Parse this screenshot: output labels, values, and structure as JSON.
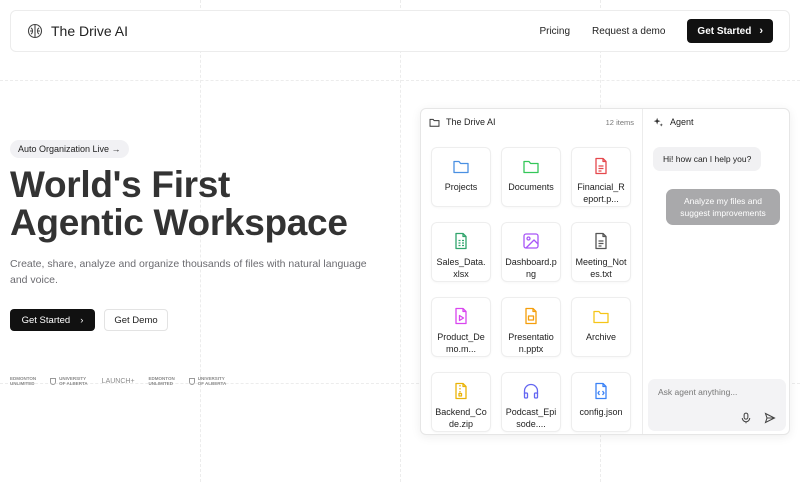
{
  "nav": {
    "brand": "The Drive AI",
    "links": [
      "Pricing",
      "Request a demo"
    ],
    "cta": "Get Started"
  },
  "hero": {
    "badge": "Auto Organization Live →",
    "title_line1": "World's First",
    "title_line2": "Agentic Workspace",
    "subtitle": "Create, share, analyze and organize thousands of files with natural language and voice.",
    "primary_button": "Get Started",
    "secondary_button": "Get Demo"
  },
  "logos": [
    {
      "name": "edmonton-unlimited",
      "line1": "EDMONTON",
      "line2": "UNLIMITED"
    },
    {
      "name": "university-of-alberta",
      "line1": "UNIVERSITY",
      "line2": "OF ALBERTA"
    },
    {
      "name": "launch",
      "text": "LAUNCH+"
    },
    {
      "name": "edmonton-unlimited-2",
      "line1": "EDMONTON",
      "line2": "UNLIMITED"
    },
    {
      "name": "university-of-alberta-2",
      "line1": "UNIVERSITY",
      "line2": "OF ALBERTA"
    }
  ],
  "drive": {
    "title": "The Drive AI",
    "count": "12 items",
    "files": [
      {
        "label": "Projects",
        "icon": "folder-icon",
        "color": "#4a90e2"
      },
      {
        "label": "Documents",
        "icon": "folder-icon",
        "color": "#34c759"
      },
      {
        "label": "Financial_Report.p...",
        "icon": "file-text-icon",
        "color": "#e5484d"
      },
      {
        "label": "Sales_Data.xlsx",
        "icon": "spreadsheet-icon",
        "color": "#30a46c"
      },
      {
        "label": "Dashboard.png",
        "icon": "image-icon",
        "color": "#a855f7"
      },
      {
        "label": "Meeting_Notes.txt",
        "icon": "file-text-icon",
        "color": "#555555"
      },
      {
        "label": "Product_Demo.m...",
        "icon": "video-file-icon",
        "color": "#d946ef"
      },
      {
        "label": "Presentation.pptx",
        "icon": "presentation-icon",
        "color": "#f59e0b"
      },
      {
        "label": "Archive",
        "icon": "folder-icon",
        "color": "#f5c518"
      },
      {
        "label": "Backend_Code.zip",
        "icon": "archive-file-icon",
        "color": "#eab308"
      },
      {
        "label": "Podcast_Episode....",
        "icon": "headphones-icon",
        "color": "#6366f1"
      },
      {
        "label": "config.json",
        "icon": "code-file-icon",
        "color": "#3b82f6"
      }
    ]
  },
  "agent": {
    "title": "Agent",
    "messages": {
      "assistant": "Hi! how can I help you?",
      "user": "Analyze my files and suggest improvements"
    },
    "input_placeholder": "Ask agent anything..."
  }
}
